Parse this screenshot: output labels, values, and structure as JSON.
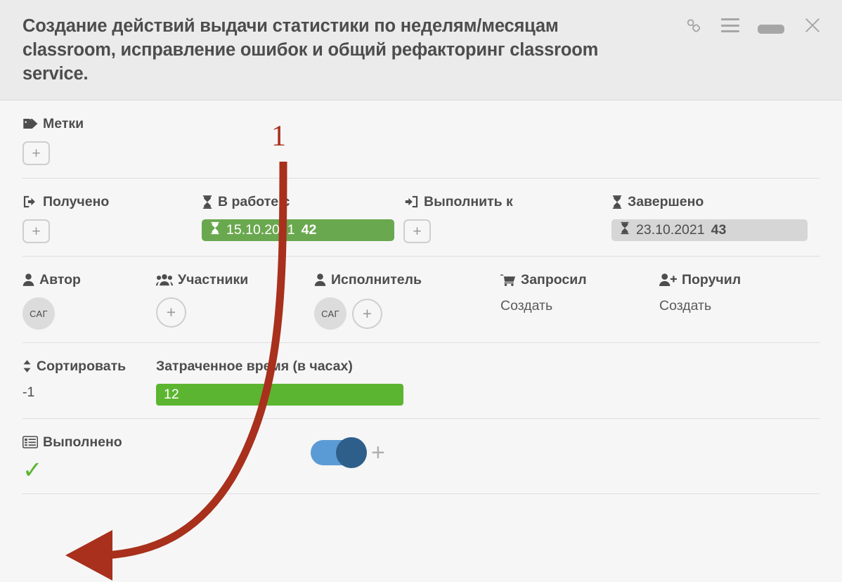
{
  "window": {
    "title": "Создание действий выдачи статистики по неделям/месяцам classroom, исправление ошибок и общий рефакторинг classroom service.",
    "icons": {
      "link": "link-icon",
      "menu": "hamburger-menu-icon",
      "minimize": "minimize-icon",
      "close": "close-icon"
    }
  },
  "sections": {
    "labels": {
      "title": "Метки",
      "icon": "tag-icon",
      "add_label": "+"
    },
    "dates": {
      "received": {
        "title": "Получено",
        "icon": "sign-out-icon",
        "add_label": "+"
      },
      "in_progress": {
        "title": "В работе с",
        "icon": "hourglass-icon",
        "value_date": "15.10.2021",
        "value_num": "42",
        "color": "#6aa84f"
      },
      "due": {
        "title": "Выполнить к",
        "icon": "sign-in-icon",
        "add_label": "+"
      },
      "completed": {
        "title": "Завершено",
        "icon": "hourglass-icon",
        "value_date": "23.10.2021",
        "value_num": "43",
        "color": "#d6d6d6"
      }
    },
    "people": {
      "author": {
        "title": "Автор",
        "icon": "user-icon",
        "avatar": "САГ"
      },
      "participants": {
        "title": "Участники",
        "icon": "users-icon",
        "add_label": "+"
      },
      "assignee": {
        "title": "Исполнитель",
        "icon": "user-icon",
        "avatar": "САГ",
        "add_label": "+"
      },
      "requested": {
        "title": "Запросил",
        "icon": "cart-icon",
        "action": "Создать"
      },
      "delegated": {
        "title": "Поручил",
        "icon": "user-plus-icon",
        "action": "Создать"
      }
    },
    "sorting": {
      "sort": {
        "title": "Сортировать",
        "icon": "sort-icon",
        "value": "-1"
      },
      "spent_time": {
        "title": "Затраченное время (в часах)",
        "value": "12",
        "color": "#5cb531"
      }
    },
    "done": {
      "title": "Выполнено",
      "icon": "list-icon",
      "checkmark": "✓",
      "toggle_on": true,
      "add_label": "+"
    }
  },
  "annotation": {
    "number": "1",
    "color": "#a8301c",
    "points_to": "Выполнено"
  }
}
